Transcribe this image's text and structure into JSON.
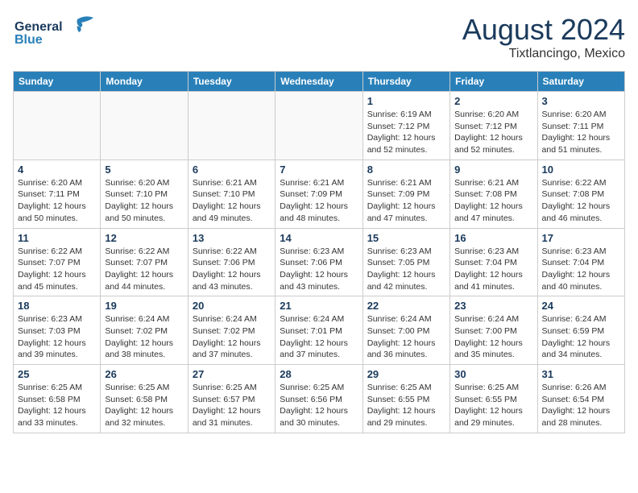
{
  "header": {
    "logo_line1": "General",
    "logo_line2": "Blue",
    "month_year": "August 2024",
    "location": "Tixtlancingo, Mexico"
  },
  "weekdays": [
    "Sunday",
    "Monday",
    "Tuesday",
    "Wednesday",
    "Thursday",
    "Friday",
    "Saturday"
  ],
  "weeks": [
    [
      {
        "day": "",
        "info": ""
      },
      {
        "day": "",
        "info": ""
      },
      {
        "day": "",
        "info": ""
      },
      {
        "day": "",
        "info": ""
      },
      {
        "day": "1",
        "info": "Sunrise: 6:19 AM\nSunset: 7:12 PM\nDaylight: 12 hours\nand 52 minutes."
      },
      {
        "day": "2",
        "info": "Sunrise: 6:20 AM\nSunset: 7:12 PM\nDaylight: 12 hours\nand 52 minutes."
      },
      {
        "day": "3",
        "info": "Sunrise: 6:20 AM\nSunset: 7:11 PM\nDaylight: 12 hours\nand 51 minutes."
      }
    ],
    [
      {
        "day": "4",
        "info": "Sunrise: 6:20 AM\nSunset: 7:11 PM\nDaylight: 12 hours\nand 50 minutes."
      },
      {
        "day": "5",
        "info": "Sunrise: 6:20 AM\nSunset: 7:10 PM\nDaylight: 12 hours\nand 50 minutes."
      },
      {
        "day": "6",
        "info": "Sunrise: 6:21 AM\nSunset: 7:10 PM\nDaylight: 12 hours\nand 49 minutes."
      },
      {
        "day": "7",
        "info": "Sunrise: 6:21 AM\nSunset: 7:09 PM\nDaylight: 12 hours\nand 48 minutes."
      },
      {
        "day": "8",
        "info": "Sunrise: 6:21 AM\nSunset: 7:09 PM\nDaylight: 12 hours\nand 47 minutes."
      },
      {
        "day": "9",
        "info": "Sunrise: 6:21 AM\nSunset: 7:08 PM\nDaylight: 12 hours\nand 47 minutes."
      },
      {
        "day": "10",
        "info": "Sunrise: 6:22 AM\nSunset: 7:08 PM\nDaylight: 12 hours\nand 46 minutes."
      }
    ],
    [
      {
        "day": "11",
        "info": "Sunrise: 6:22 AM\nSunset: 7:07 PM\nDaylight: 12 hours\nand 45 minutes."
      },
      {
        "day": "12",
        "info": "Sunrise: 6:22 AM\nSunset: 7:07 PM\nDaylight: 12 hours\nand 44 minutes."
      },
      {
        "day": "13",
        "info": "Sunrise: 6:22 AM\nSunset: 7:06 PM\nDaylight: 12 hours\nand 43 minutes."
      },
      {
        "day": "14",
        "info": "Sunrise: 6:23 AM\nSunset: 7:06 PM\nDaylight: 12 hours\nand 43 minutes."
      },
      {
        "day": "15",
        "info": "Sunrise: 6:23 AM\nSunset: 7:05 PM\nDaylight: 12 hours\nand 42 minutes."
      },
      {
        "day": "16",
        "info": "Sunrise: 6:23 AM\nSunset: 7:04 PM\nDaylight: 12 hours\nand 41 minutes."
      },
      {
        "day": "17",
        "info": "Sunrise: 6:23 AM\nSunset: 7:04 PM\nDaylight: 12 hours\nand 40 minutes."
      }
    ],
    [
      {
        "day": "18",
        "info": "Sunrise: 6:23 AM\nSunset: 7:03 PM\nDaylight: 12 hours\nand 39 minutes."
      },
      {
        "day": "19",
        "info": "Sunrise: 6:24 AM\nSunset: 7:02 PM\nDaylight: 12 hours\nand 38 minutes."
      },
      {
        "day": "20",
        "info": "Sunrise: 6:24 AM\nSunset: 7:02 PM\nDaylight: 12 hours\nand 37 minutes."
      },
      {
        "day": "21",
        "info": "Sunrise: 6:24 AM\nSunset: 7:01 PM\nDaylight: 12 hours\nand 37 minutes."
      },
      {
        "day": "22",
        "info": "Sunrise: 6:24 AM\nSunset: 7:00 PM\nDaylight: 12 hours\nand 36 minutes."
      },
      {
        "day": "23",
        "info": "Sunrise: 6:24 AM\nSunset: 7:00 PM\nDaylight: 12 hours\nand 35 minutes."
      },
      {
        "day": "24",
        "info": "Sunrise: 6:24 AM\nSunset: 6:59 PM\nDaylight: 12 hours\nand 34 minutes."
      }
    ],
    [
      {
        "day": "25",
        "info": "Sunrise: 6:25 AM\nSunset: 6:58 PM\nDaylight: 12 hours\nand 33 minutes."
      },
      {
        "day": "26",
        "info": "Sunrise: 6:25 AM\nSunset: 6:58 PM\nDaylight: 12 hours\nand 32 minutes."
      },
      {
        "day": "27",
        "info": "Sunrise: 6:25 AM\nSunset: 6:57 PM\nDaylight: 12 hours\nand 31 minutes."
      },
      {
        "day": "28",
        "info": "Sunrise: 6:25 AM\nSunset: 6:56 PM\nDaylight: 12 hours\nand 30 minutes."
      },
      {
        "day": "29",
        "info": "Sunrise: 6:25 AM\nSunset: 6:55 PM\nDaylight: 12 hours\nand 29 minutes."
      },
      {
        "day": "30",
        "info": "Sunrise: 6:25 AM\nSunset: 6:55 PM\nDaylight: 12 hours\nand 29 minutes."
      },
      {
        "day": "31",
        "info": "Sunrise: 6:26 AM\nSunset: 6:54 PM\nDaylight: 12 hours\nand 28 minutes."
      }
    ]
  ]
}
